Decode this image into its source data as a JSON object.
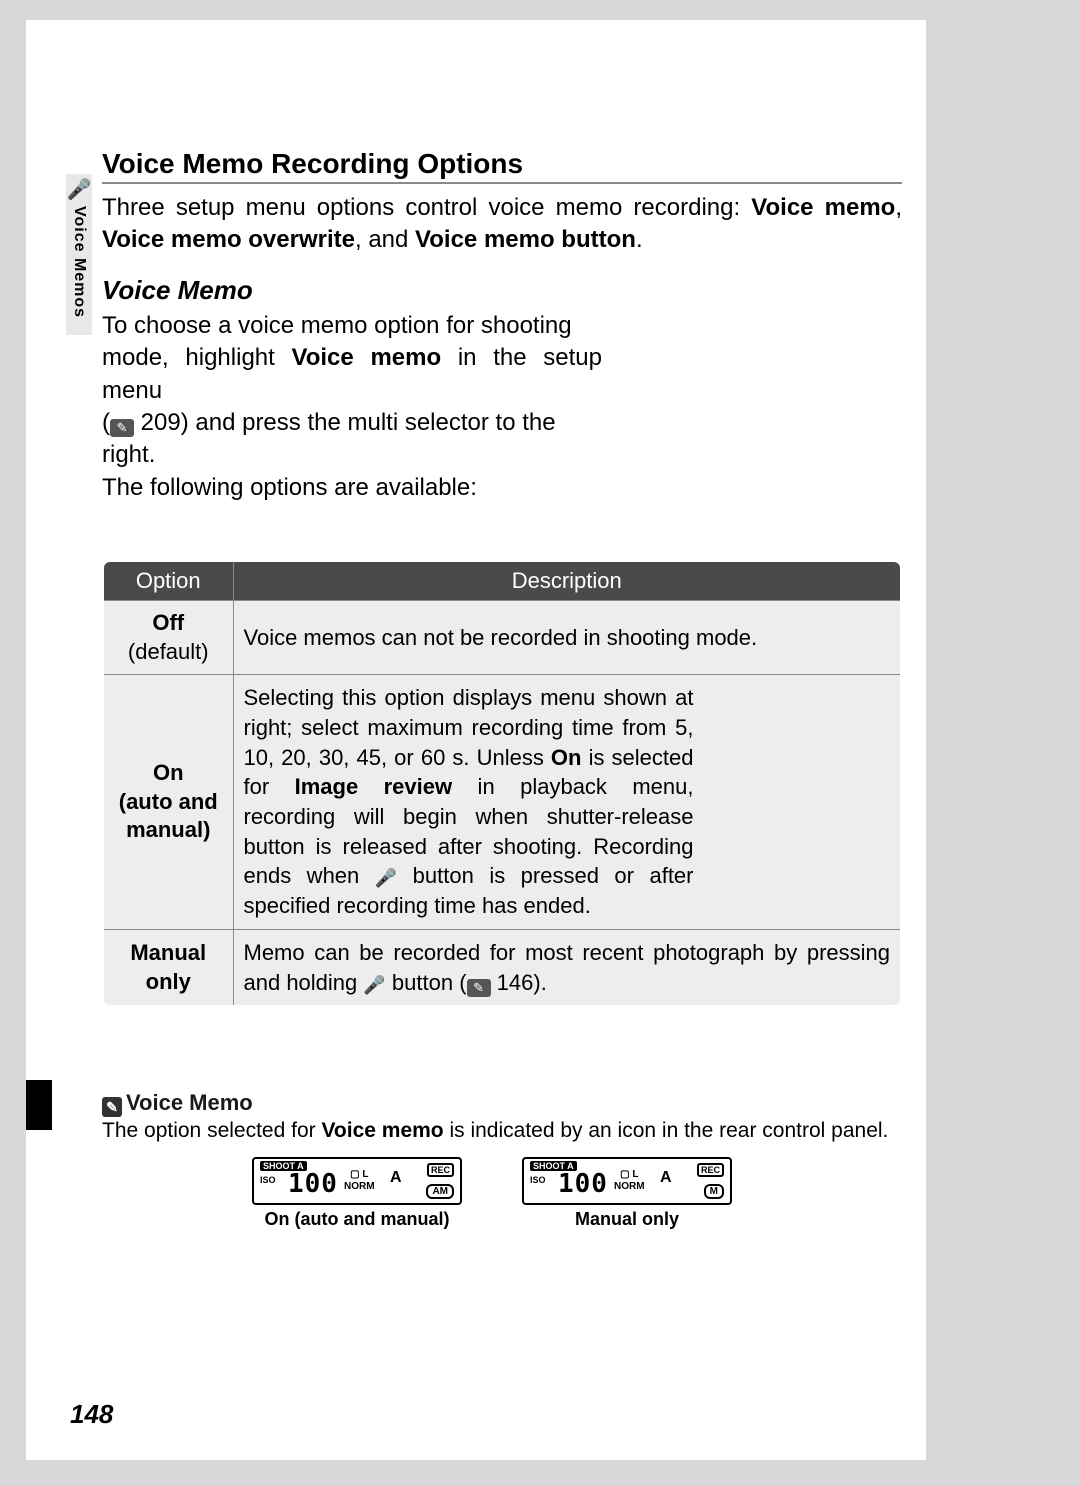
{
  "side_tab": {
    "icon": "🎤",
    "label": "Voice Memos"
  },
  "heading": "Voice Memo Recording Options",
  "intro": {
    "pre": "Three setup menu options control voice memo recording: ",
    "b1": "Voice memo",
    "mid1": ", ",
    "b2": "Voice memo overwrite",
    "mid2": ", and ",
    "b3": "Voice memo button",
    "post": "."
  },
  "sub_heading": "Voice Memo",
  "body": {
    "l1": "To choose a voice memo option for shooting",
    "l2a": "mode, highlight ",
    "l2b": "Voice memo",
    "l2c": " in the setup menu",
    "l3a": "(",
    "l3_ref": "209",
    "l3b": ") and press the multi selector to the right.",
    "l4": "The following options are available:"
  },
  "table": {
    "h1": "Option",
    "h2": "Description",
    "rows": [
      {
        "opt_main": "Off",
        "opt_sub": "(default)",
        "desc_plain": "Voice memos can not be recorded in shooting mode."
      },
      {
        "opt_main": "On",
        "opt_sub": "(auto and manual)",
        "desc_pre": "Selecting this option displays menu shown at right; select maximum recording time from 5, 10, 20, 30, 45, or 60 s.  Unless ",
        "desc_b1": "On",
        "desc_mid1": " is selected for ",
        "desc_b2": "Image review",
        "desc_mid2": " in playback menu, recording will begin when shutter-release button is released after shooting.  Recording ends when ",
        "desc_post": " button is pressed or after specified recording time has ended."
      },
      {
        "opt_main": "Manual only",
        "opt_sub": "",
        "desc_pre": "Memo can be recorded for most recent photograph by pressing and holding ",
        "desc_mid": " button (",
        "desc_ref": "146",
        "desc_post": ")."
      }
    ]
  },
  "note": {
    "title": "Voice Memo",
    "body_pre": "The option selected for ",
    "body_b": "Voice memo",
    "body_post": " is indicated by an icon in the rear control panel."
  },
  "panels": {
    "shoot": "SHOOT A",
    "iso": "ISO",
    "num": "100",
    "mid_top": "▢ L",
    "mid_bot": "NORM",
    "a": "A",
    "rec": "REC",
    "mode1": "AM",
    "mode2": "M",
    "cap1": "On (auto and manual)",
    "cap2": "Manual only"
  },
  "page_num": "148",
  "chart_data": {
    "type": "table",
    "title": "Voice Memo options",
    "columns": [
      "Option",
      "Description"
    ],
    "rows": [
      [
        "Off (default)",
        "Voice memos can not be recorded in shooting mode."
      ],
      [
        "On (auto and manual)",
        "Selecting this option displays menu shown at right; select maximum recording time from 5, 10, 20, 30, 45, or 60 s. Unless On is selected for Image review in playback menu, recording will begin when shutter-release button is released after shooting. Recording ends when 🎤 button is pressed or after specified recording time has ended."
      ],
      [
        "Manual only",
        "Memo can be recorded for most recent photograph by pressing and holding 🎤 button (146)."
      ]
    ]
  }
}
